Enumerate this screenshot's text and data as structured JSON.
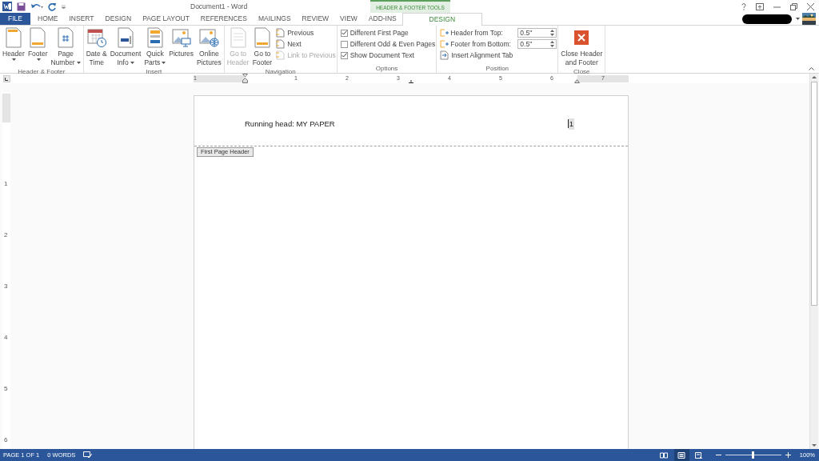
{
  "title_bar": {
    "title": "Document1 - Word",
    "context_label": "HEADER & FOOTER TOOLS"
  },
  "tabs": [
    {
      "label": "FILE",
      "kind": "file",
      "selected": false
    },
    {
      "label": "HOME",
      "kind": "normal",
      "selected": false
    },
    {
      "label": "INSERT",
      "kind": "normal",
      "selected": false
    },
    {
      "label": "DESIGN",
      "kind": "normal",
      "selected": false
    },
    {
      "label": "PAGE LAYOUT",
      "kind": "normal",
      "selected": false
    },
    {
      "label": "REFERENCES",
      "kind": "normal",
      "selected": false
    },
    {
      "label": "MAILINGS",
      "kind": "normal",
      "selected": false
    },
    {
      "label": "REVIEW",
      "kind": "normal",
      "selected": false
    },
    {
      "label": "VIEW",
      "kind": "normal",
      "selected": false
    },
    {
      "label": "ADD-INS",
      "kind": "normal",
      "selected": false
    },
    {
      "label": "DESIGN",
      "kind": "contextual",
      "selected": true
    }
  ],
  "ribbon_groups": [
    {
      "label": "Header & Footer",
      "items": [
        {
          "kind": "large",
          "lines": [
            "Header"
          ],
          "dropdown": true,
          "disabled": false
        },
        {
          "kind": "large",
          "lines": [
            "Footer"
          ],
          "dropdown": true,
          "disabled": false
        },
        {
          "kind": "large",
          "lines": [
            "Page",
            "Number"
          ],
          "dropdown": true,
          "disabled": false
        }
      ]
    },
    {
      "label": "Insert",
      "items": [
        {
          "kind": "large",
          "lines": [
            "Date &",
            "Time"
          ],
          "dropdown": false,
          "disabled": false
        },
        {
          "kind": "large",
          "lines": [
            "Document",
            "Info"
          ],
          "dropdown": true,
          "disabled": false
        },
        {
          "kind": "large",
          "lines": [
            "Quick",
            "Parts"
          ],
          "dropdown": true,
          "disabled": false
        },
        {
          "kind": "large",
          "lines": [
            "Pictures"
          ],
          "dropdown": false,
          "disabled": false
        },
        {
          "kind": "large",
          "lines": [
            "Online",
            "Pictures"
          ],
          "dropdown": false,
          "disabled": false
        }
      ]
    },
    {
      "label": "Navigation",
      "items": [
        {
          "kind": "large",
          "lines": [
            "Go to",
            "Header"
          ],
          "dropdown": false,
          "disabled": true
        },
        {
          "kind": "large",
          "lines": [
            "Go to",
            "Footer"
          ],
          "dropdown": false,
          "disabled": false
        },
        {
          "kind": "small",
          "label": "Previous",
          "disabled": false
        },
        {
          "kind": "small",
          "label": "Next",
          "disabled": false
        },
        {
          "kind": "small",
          "label": "Link to Previous",
          "disabled": true
        }
      ]
    },
    {
      "label": "Options",
      "items": [
        {
          "kind": "checkbox",
          "label": "Different First Page",
          "checked": true
        },
        {
          "kind": "checkbox",
          "label": "Different Odd & Even Pages",
          "checked": false
        },
        {
          "kind": "checkbox",
          "label": "Show Document Text",
          "checked": true
        }
      ]
    },
    {
      "label": "Position",
      "items": [
        {
          "kind": "spin",
          "label": "Header from Top:",
          "value": "0.5\""
        },
        {
          "kind": "spin",
          "label": "Footer from Bottom:",
          "value": "0.5\""
        },
        {
          "kind": "small",
          "label": "Insert Alignment Tab",
          "disabled": false
        }
      ]
    },
    {
      "label": "Close",
      "items": [
        {
          "kind": "close",
          "lines": [
            "Close Header",
            "and Footer"
          ],
          "dropdown": false,
          "disabled": false
        }
      ]
    }
  ],
  "ruler": {
    "horizontal": [
      "1",
      "1",
      "2",
      "3",
      "4",
      "5",
      "6",
      "7"
    ],
    "vertical": [
      "1",
      "2",
      "3",
      "4",
      "5",
      "6"
    ]
  },
  "document": {
    "header_text": "Running head: MY PAPER",
    "page_number": "1",
    "header_tag": "First Page Header"
  },
  "status_bar": {
    "page": "PAGE 1 OF 1",
    "words": "0 WORDS",
    "views": [
      {
        "selected": false
      },
      {
        "selected": true
      },
      {
        "selected": false
      }
    ],
    "zoom": "100%",
    "zoom_level": {
      "level": 0.5
    }
  }
}
